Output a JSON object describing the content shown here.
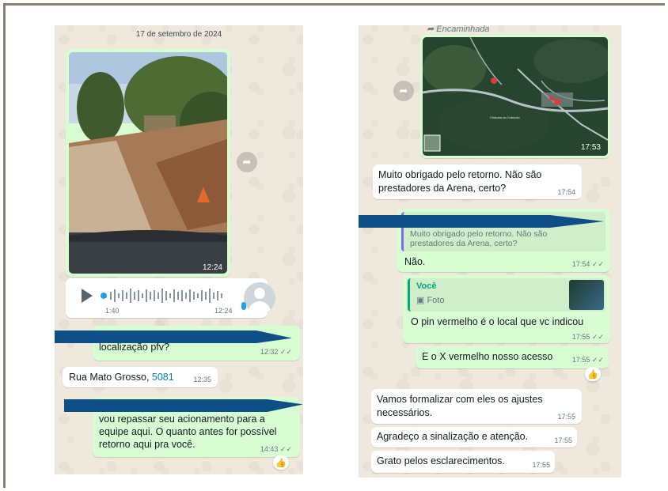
{
  "left": {
    "date_label": "17 de setembro de 2024",
    "photo_time": "12:24",
    "audio": {
      "duration": "1:40",
      "time": "12:24"
    },
    "msg_request": {
      "text": "localização pfv?",
      "time": "12:32",
      "ticks": "✓✓"
    },
    "msg_address": {
      "text": "Rua Mato Grosso, ",
      "number": "5081",
      "time": "12:35"
    },
    "msg_forward": {
      "text": "vou repassar seu acionamento para a equipe aqui. O quanto antes for possível retorno aqui pra você.",
      "time": "14:43",
      "ticks": "✓✓"
    },
    "reaction": "👍"
  },
  "right": {
    "forwarded_label": "Encaminhada",
    "map_time": "17:53",
    "map_place_label": "Chácara do Cubículo",
    "msg_thanks": {
      "text": "Muito obrigado pelo retorno. Não são prestadores da Arena, certo?",
      "time": "17:54"
    },
    "quote_thanks": "Muito obrigado pelo retorno. Não são prestadores da Arena, certo?",
    "msg_no": {
      "text": "Não.",
      "time": "17:54",
      "ticks": "✓✓"
    },
    "quote_voce": {
      "author": "Você",
      "type": "Foto"
    },
    "msg_pin": {
      "text": "O pin vermelho é o local que vc indicou",
      "time": "17:55",
      "ticks": "✓✓"
    },
    "msg_x": {
      "text": "E o X vermelho nosso acesso",
      "time": "17:55",
      "ticks": "✓✓"
    },
    "reaction": "👍",
    "msg_formalize": {
      "text": "Vamos formalizar com eles os ajustes necessários.",
      "time": "17:55"
    },
    "msg_agradeco": {
      "text": "Agradeço a sinalização e atenção.",
      "time": "17:55"
    },
    "msg_grato": {
      "text": "Grato pelos esclarecimentos.",
      "time": "17:55"
    }
  },
  "colors": {
    "chat_bg": "#efe8dc",
    "outgoing_bubble": "#d9fdd3",
    "incoming_bubble": "#ffffff",
    "redaction": "#0f4f87",
    "accent_green": "#06a884",
    "link_blue": "#027eb5"
  }
}
